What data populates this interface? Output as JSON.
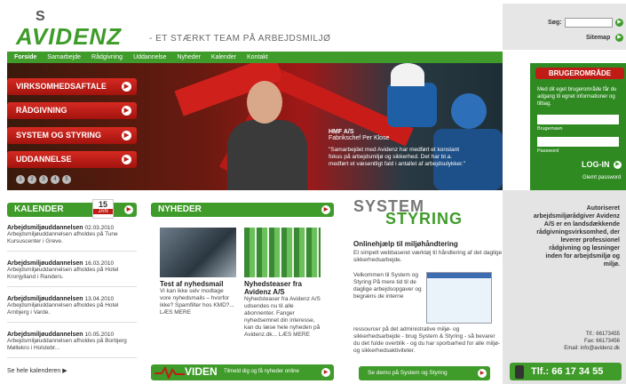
{
  "header": {
    "logo_text": "AVIDENZ",
    "tagline": "- ET STÆRKT TEAM PÅ ARBEJDSMILJØ",
    "search_label": "Søg:",
    "sitemap_label": "Sitemap"
  },
  "nav": [
    "Forside",
    "Samarbejde",
    "Rådgivning",
    "Uddannelse",
    "Nyheder",
    "Kalender",
    "Kontakt"
  ],
  "menu": [
    "VIRKSOMHEDSAFTALE",
    "RÅDGIVNING",
    "SYSTEM OG STYRING",
    "UDDANNELSE"
  ],
  "slides": [
    "1",
    "2",
    "3",
    "4",
    "5"
  ],
  "hero": {
    "name": "HMF A/S",
    "role": "Fabrikschef Per Klose",
    "quote": "\"Samarbejdet med Avidenz har medført et konstant fokus på arbejdsmiljø og sikkerhed. Det har bl.a. medført et væsentligt fald i antallet af arbejdsulykker.\""
  },
  "login": {
    "title": "BRUGEROMRÅDE",
    "text": "Med dit eget brugerområde får du adgang til egnet informationer og tilbag.",
    "user_label": "Brugernavn",
    "pass_label": "Password",
    "button": "LOG-IN",
    "forgot": "Glemt password"
  },
  "calendar": {
    "title": "KALENDER",
    "day": "15",
    "month": "JAN",
    "events": [
      {
        "title": "Arbejdsmiljøuddannelsen",
        "date": "02.03.2010",
        "desc": "Arbejdsmiljøuddannelsen afholdes på Tune Kursuscenter i Greve."
      },
      {
        "title": "Arbejdsmiljøuddannelsen",
        "date": "16.03.2010",
        "desc": "Arbejdsmiljøuddannelsen afholdes på Hotel Kronjylland i Randers."
      },
      {
        "title": "Arbejdsmiljøuddannelsen",
        "date": "13.04.2010",
        "desc": "Arbejdsmiljøuddannelsen afholdes på Hotel Arnbjerg i Varde."
      },
      {
        "title": "Arbejdsmiljøuddannelsen",
        "date": "10.05.2010",
        "desc": "Arbejdsmiljøuddannelsen afholdes på Borbjerg Møllekro i Holstebr..."
      }
    ],
    "more": "Se hele kalenderen"
  },
  "news": {
    "title": "NYHEDER",
    "items": [
      {
        "heading": "Test af nyhedsmail",
        "text": "Vi kan ikke selv modtage vore nyhedsmails – hvorfor ikke? Spamfilter hos KMD?... LÆS MERE"
      },
      {
        "heading": "Nyhedsteaser fra Avidenz A/S",
        "text": "Nyhedsteaser fra Avidenz A/S udsendes nu til alle abonnenter. Fanger nyhedsemnet din interesse, kan du læse hele nyheden på Avidenz.dk... LÆS MERE"
      }
    ],
    "footer_brand": "VIDEN",
    "footer_text": "Tilmeld dig og få nyheder online"
  },
  "system": {
    "logo_top": "SYSTEM",
    "logo_bottom": "STYRING",
    "title": "Onlinehjælp til miljøhåndtering",
    "subtitle": "Et simpelt webbaseret værktøj til håndtering af det daglige sikkerhedsarbejde.",
    "body": "Velkommen til System og Styring På mere tid til de daglige arbejdsopgaver og begræns de interne",
    "body2": "ressourcer på det administrative miljø- og sikkerhedsarbejde - brug System & Styring - så bevarer du det fulde overblik - og du har sporbarhed for alle miljø- og sikkerhedsaktiviteter.",
    "button": "Se demo på System og Styring"
  },
  "about": {
    "text": "Autoriseret arbejdsmiljørådgiver Avidenz A/S er en landsdækkende rådgivningsvirksomhed, der leverer professionel rådgivning og løsninger inden for arbejdsmiljø og miljø.",
    "tlf": "Tlf.: 66173455",
    "fax": "Fax: 66173456",
    "email": "Email: info@avidenz.dk",
    "phone": "Tlf.: 66 17 34 55"
  },
  "colors": {
    "brand_green": "#3f9b2a",
    "brand_red": "#c01c16"
  }
}
